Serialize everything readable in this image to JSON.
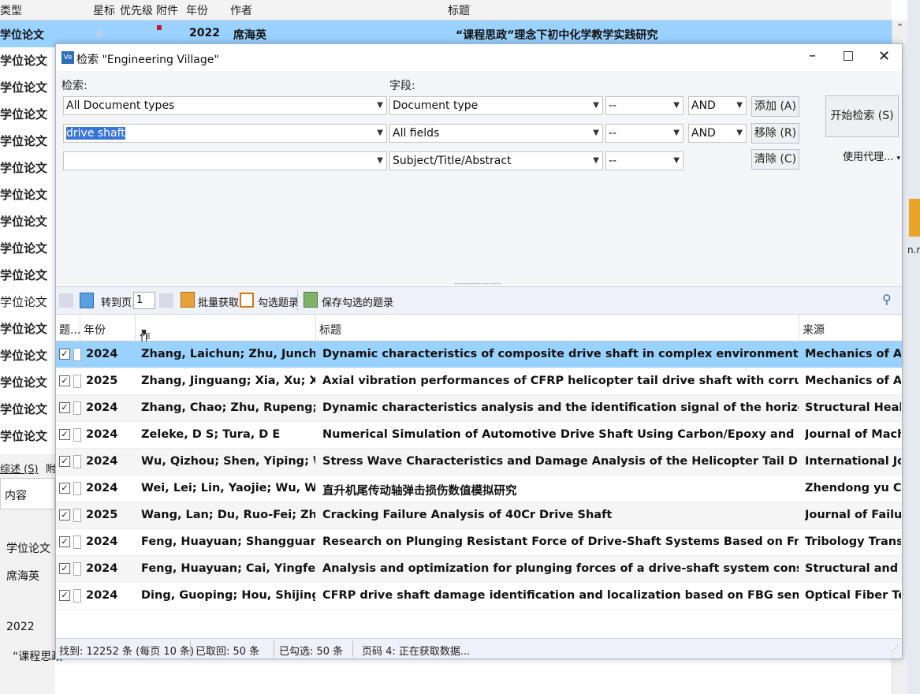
{
  "background_table": {
    "headers": [
      "类型",
      "星标",
      "优先级",
      "附件",
      "年份",
      "作者",
      "标题"
    ],
    "selected_row": {
      "type": "学位论文",
      "year": "2022",
      "author": "席海英",
      "title": "“课程思政”理念下初中化学教学实践研究"
    },
    "type_labels": [
      "学位论文",
      "学位论文",
      "学位论文",
      "学位论文",
      "学位论文",
      "学位论文",
      "学位论文",
      "学位论文",
      "学位论文",
      "学位论文",
      "学位论文",
      "学位论文",
      "学位论文",
      "学位论文",
      "学位论文"
    ],
    "lower_panel": {
      "tab1": "综述 (S)",
      "tab2": "附",
      "content_header": "内容",
      "values": [
        "学位论文",
        "席海英",
        "2022",
        "“课程思政"
      ]
    },
    "desktop_text": "n.ra"
  },
  "dialog": {
    "title": "检索 \"Engineering Village\"",
    "search_label": "检索:",
    "field_label": "字段:",
    "rows": [
      {
        "term": "All Document types",
        "field": "Document type",
        "mod": "--",
        "op": "AND"
      },
      {
        "term": "drive shaft",
        "field": "All fields",
        "mod": "--",
        "op": "AND"
      },
      {
        "term": "",
        "field": "Subject/Title/Abstract",
        "mod": "--",
        "op": ""
      }
    ],
    "add_btn": "添加 (A)",
    "remove_btn": "移除 (R)",
    "clear_btn": "清除 (C)",
    "start_btn": "开始检索 (S)",
    "proxy_btn": "使用代理...",
    "toolbar": {
      "goto": "转到页",
      "page": "1",
      "batch": "批量获取",
      "check": "勾选题录",
      "save": "保存勾选的题录"
    },
    "columns": [
      "题...",
      "年份",
      "作者",
      "标题",
      "来源"
    ],
    "results": [
      {
        "year": "2024",
        "author": "Zhang, Laichun; Zhu, Junchao; Zha",
        "title": "Dynamic characteristics of composite drive shaft in complex environment based on Carrera uni",
        "source": "Mechanics of Adv.."
      },
      {
        "year": "2025",
        "author": "Zhang, Jinguang; Xia, Xu; Xiao, Sha",
        "title": "Axial vibration performances of CFRP helicopter tail drive shaft with corrugated structure",
        "source": "Mechanics of Adv.."
      },
      {
        "year": "2024",
        "author": "Zhang, Chao; Zhu, Rupeng; Wang,",
        "title": "Dynamic characteristics analysis and the identification signal of the horizontal tail drive shaft s",
        "source": "Structural Health .."
      },
      {
        "year": "2024",
        "author": "Zeleke, D S; Tura, D E",
        "title": "Numerical Simulation of Automotive Drive Shaft Using Carbon/Epoxy and Kevlar/Epoxy Compo",
        "source": "Journal of Machin.."
      },
      {
        "year": "2024",
        "author": "Wu, Qizhou; Shen, Yiping; Wang, S",
        "title": "Stress Wave Characteristics and Damage Analysis of the Helicopter Tail Drive Shaft with the Hi",
        "source": "International Jour.."
      },
      {
        "year": "2024",
        "author": "Wei, Lei; Lin, Yaojie; Wu, Wangjiar",
        "title": "直升机尾传动轴弹击损伤数值模拟研究",
        "source": "Zhendong yu Cho.."
      },
      {
        "year": "2025",
        "author": "Wang, Lan; Du, Ruo-Fei; Zhang, Xu",
        "title": "Cracking Failure Analysis of 40Cr Drive Shaft",
        "source": "Journal of Failure .."
      },
      {
        "year": "2024",
        "author": "Feng, Huayuan; Shangguan, Wen-..",
        "title": "Research on Plunging Resistant Force of Drive-Shaft Systems Based on Fractal Methods",
        "source": "Tribology Transac.."
      },
      {
        "year": "2024",
        "author": "Feng, Huayuan; Cai, Yingfeng; Sha",
        "title": "Analysis and optimization for plunging forces of a drive-shaft system considering rough surfac",
        "source": "Structural and Mu.."
      },
      {
        "year": "2024",
        "author": "Ding, Guoping; Hou, Shijing",
        "title": "CFRP drive shaft damage identification and localization based on FBG sensing network and GW",
        "source": "Optical Fiber Tech.."
      }
    ],
    "status": {
      "found": "找到: 12252 条 (每页 10 条)",
      "fetched": "已取回: 50 条",
      "checked": "已勾选: 50 条",
      "page": "页码 4: 正在获取数据..."
    }
  }
}
